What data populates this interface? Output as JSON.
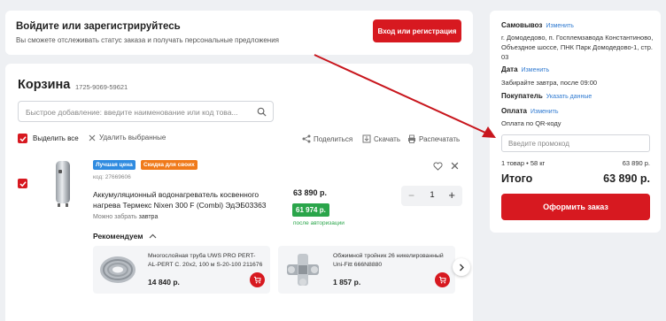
{
  "auth": {
    "title": "Войдите или зарегистрируйтесь",
    "subtitle": "Вы сможете отслеживать статус заказа и получать персональные предложения",
    "button": "Вход или регистрация"
  },
  "cart": {
    "title": "Корзина",
    "number": "1725-9069-59621",
    "quick_add_placeholder": "Быстрое добавление: введите наименование или код това...",
    "select_all": "Выделить все",
    "delete_selected": "Удалить выбранные",
    "share": "Поделиться",
    "download": "Скачать",
    "print": "Распечатать"
  },
  "item": {
    "badge_best": "Лучшая цена",
    "badge_discount": "Скидка для своих",
    "code": "код: 27669606",
    "name": "Аккумуляционный водонагреватель косвенного нагрева Термекс Nixen 300 F (Combi) ЭдЭБ03363",
    "pickup_prefix": "Можно забрать",
    "pickup_when": "завтра",
    "price": "63 890 р.",
    "auth_price": "61 974 р.",
    "after_auth": "после авторизации",
    "quantity": "1",
    "minus": "−",
    "plus": "+"
  },
  "recommended": {
    "title": "Рекомендуем",
    "items": [
      {
        "name": "Многослойная труба UWS PRO PERT-AL-PERT С. 20x2, 100 м S-20-100 211676",
        "price": "14 840 р."
      },
      {
        "name": "Обжимной тройник 26 никелированный Uni-Fitt 666N8880",
        "price": "1 857 р."
      }
    ]
  },
  "summary": {
    "pickup_label": "Самовывоз",
    "pickup_change": "Изменить",
    "pickup_address": "г. Домодедово, п. Госплемзавода Константиново, Объездное шоссе, ПНК Парк Домодедово-1, стр. 03",
    "date_label": "Дата",
    "date_change": "Изменить",
    "date_text": "Забирайте завтра, после 09:00",
    "buyer_label": "Покупатель",
    "buyer_link": "Указать данные",
    "payment_label": "Оплата",
    "payment_change": "Изменить",
    "payment_text": "Оплата по QR-коду",
    "promo_placeholder": "Введите промокод",
    "items_line": "1 товар • 58 кг",
    "items_price": "63 890 р.",
    "total_label": "Итого",
    "total_value": "63 890 р.",
    "checkout": "Оформить заказ"
  },
  "colors": {
    "accent": "#d71920",
    "green": "#2aa54a",
    "link": "#2f7ad1",
    "badge_blue": "#2f8be0",
    "badge_orange": "#f07a1a"
  },
  "icons": [
    "search-icon",
    "checkmark-icon",
    "close-icon",
    "share-icon",
    "download-icon",
    "print-icon",
    "heart-icon",
    "chevron-up-icon",
    "chevron-right-icon",
    "cart-icon"
  ]
}
